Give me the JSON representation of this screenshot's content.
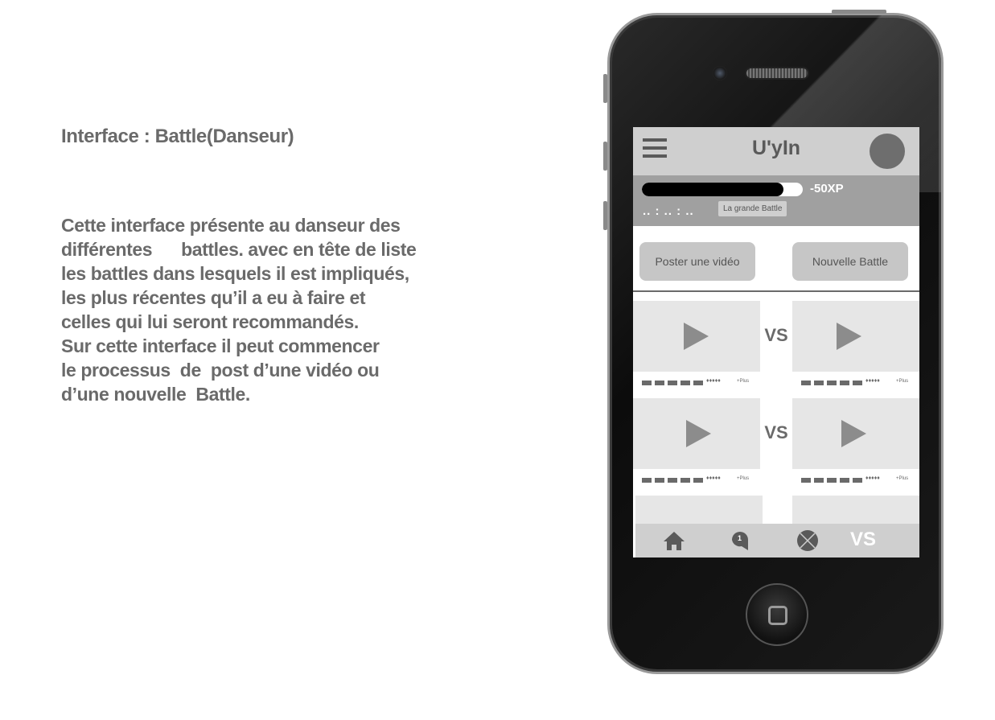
{
  "description": {
    "title": "Interface : Battle(Danseur)",
    "lines": [
      "Cette interface présente au danseur des",
      "différentes      battles. avec en tête de liste",
      "les battles dans lesquels il est impliqués,",
      "les plus récentes qu’il a eu à faire et",
      "celles qui lui seront recommandés.",
      "Sur cette interface il peut commencer",
      "le processus  de  post d’une vidéo ou",
      "d’une nouvelle  Battle."
    ]
  },
  "app": {
    "title": "U'yIn",
    "icons": {
      "menu": "hamburger-menu-icon",
      "avatar": "profile-avatar"
    }
  },
  "xp": {
    "progress": 0.88,
    "label": "-50XP",
    "dots": ".. : .. : ..",
    "grand_battle_label": "La grande Battle"
  },
  "actions": {
    "post_video": "Poster une vidéo",
    "new_battle": "Nouvelle Battle"
  },
  "battles": [
    {
      "vs": "VS",
      "left": {
        "stars": "♦♦♦♦♦",
        "plus": "+Plus"
      },
      "right": {
        "stars": "♦♦♦♦♦",
        "plus": "+Plus"
      }
    },
    {
      "vs": "VS",
      "left": {
        "stars": "♦♦♦♦♦",
        "plus": "+Plus"
      },
      "right": {
        "stars": "♦♦♦♦♦",
        "plus": "+Plus"
      }
    }
  ],
  "bottom_nav": {
    "items": [
      "home-icon",
      "chat-bubble-icon",
      "close-circle-icon",
      "vs-tab"
    ],
    "chat_badge": "1",
    "vs_label": "VS"
  },
  "colors": {
    "text_gray": "#6a6a6a",
    "bar_gray": "#cfcfcf",
    "xp_bar": "#a0a0a0",
    "button_gray": "#c6c6c6"
  }
}
